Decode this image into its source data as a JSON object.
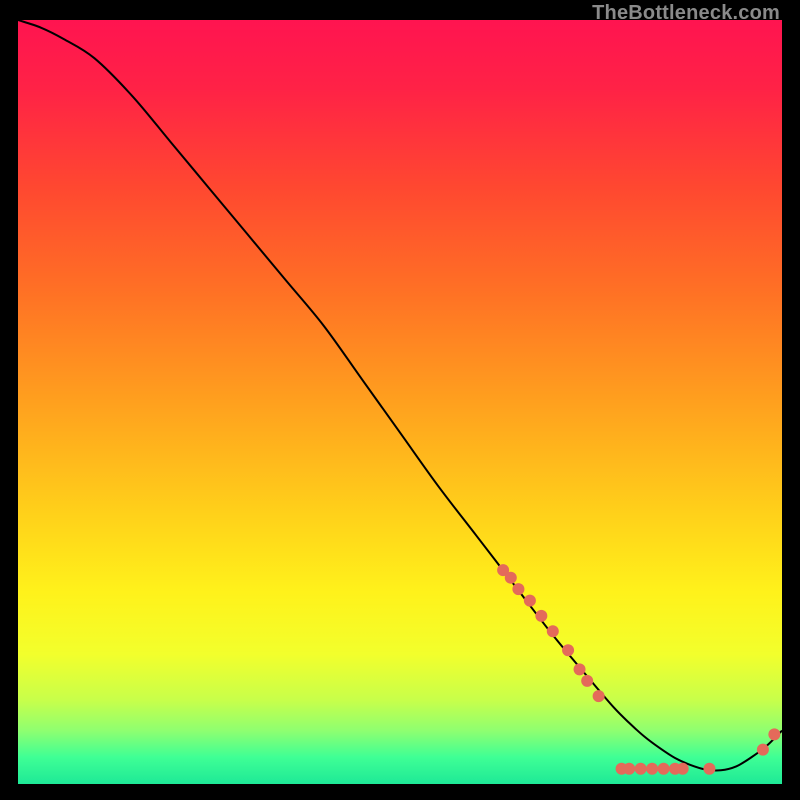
{
  "watermark": "TheBottleneck.com",
  "chart_data": {
    "type": "line",
    "title": "",
    "xlabel": "",
    "ylabel": "",
    "xlim": [
      0,
      100
    ],
    "ylim": [
      0,
      100
    ],
    "grid": false,
    "legend": false,
    "background_gradient": {
      "stops": [
        {
          "offset": 0.0,
          "color": "#ff1450"
        },
        {
          "offset": 0.09,
          "color": "#ff2246"
        },
        {
          "offset": 0.22,
          "color": "#ff4830"
        },
        {
          "offset": 0.35,
          "color": "#ff6f25"
        },
        {
          "offset": 0.5,
          "color": "#ffa01e"
        },
        {
          "offset": 0.65,
          "color": "#ffd21a"
        },
        {
          "offset": 0.75,
          "color": "#fff21b"
        },
        {
          "offset": 0.83,
          "color": "#f2ff2c"
        },
        {
          "offset": 0.89,
          "color": "#c8ff4a"
        },
        {
          "offset": 0.93,
          "color": "#8fff70"
        },
        {
          "offset": 0.965,
          "color": "#3fff95"
        },
        {
          "offset": 1.0,
          "color": "#1ee997"
        }
      ]
    },
    "series": [
      {
        "name": "bottleneck-curve",
        "color": "#000000",
        "x": [
          0,
          3,
          6,
          10,
          15,
          20,
          25,
          30,
          35,
          40,
          45,
          50,
          55,
          60,
          65,
          70,
          75,
          78,
          80,
          82,
          84,
          86,
          88,
          90,
          92,
          94,
          96,
          98,
          100
        ],
        "y": [
          100,
          99,
          97.5,
          95,
          90,
          84,
          78,
          72,
          66,
          60,
          53,
          46,
          39,
          32.5,
          26,
          19.5,
          13.5,
          10,
          8,
          6.2,
          4.7,
          3.4,
          2.5,
          1.9,
          1.8,
          2.3,
          3.5,
          5.0,
          7.0
        ]
      }
    ],
    "markers": {
      "name": "highlight-points",
      "color": "#e46a5a",
      "radius_px": 6,
      "points": [
        {
          "x": 63.5,
          "y": 28.0
        },
        {
          "x": 64.5,
          "y": 27.0
        },
        {
          "x": 65.5,
          "y": 25.5
        },
        {
          "x": 67.0,
          "y": 24.0
        },
        {
          "x": 68.5,
          "y": 22.0
        },
        {
          "x": 70.0,
          "y": 20.0
        },
        {
          "x": 72.0,
          "y": 17.5
        },
        {
          "x": 73.5,
          "y": 15.0
        },
        {
          "x": 74.5,
          "y": 13.5
        },
        {
          "x": 76.0,
          "y": 11.5
        },
        {
          "x": 79.0,
          "y": 2.0
        },
        {
          "x": 80.0,
          "y": 2.0
        },
        {
          "x": 81.5,
          "y": 2.0
        },
        {
          "x": 83.0,
          "y": 2.0
        },
        {
          "x": 84.5,
          "y": 2.0
        },
        {
          "x": 86.0,
          "y": 2.0
        },
        {
          "x": 87.0,
          "y": 2.0
        },
        {
          "x": 90.5,
          "y": 2.0
        },
        {
          "x": 97.5,
          "y": 4.5
        },
        {
          "x": 99.0,
          "y": 6.5
        }
      ]
    }
  }
}
